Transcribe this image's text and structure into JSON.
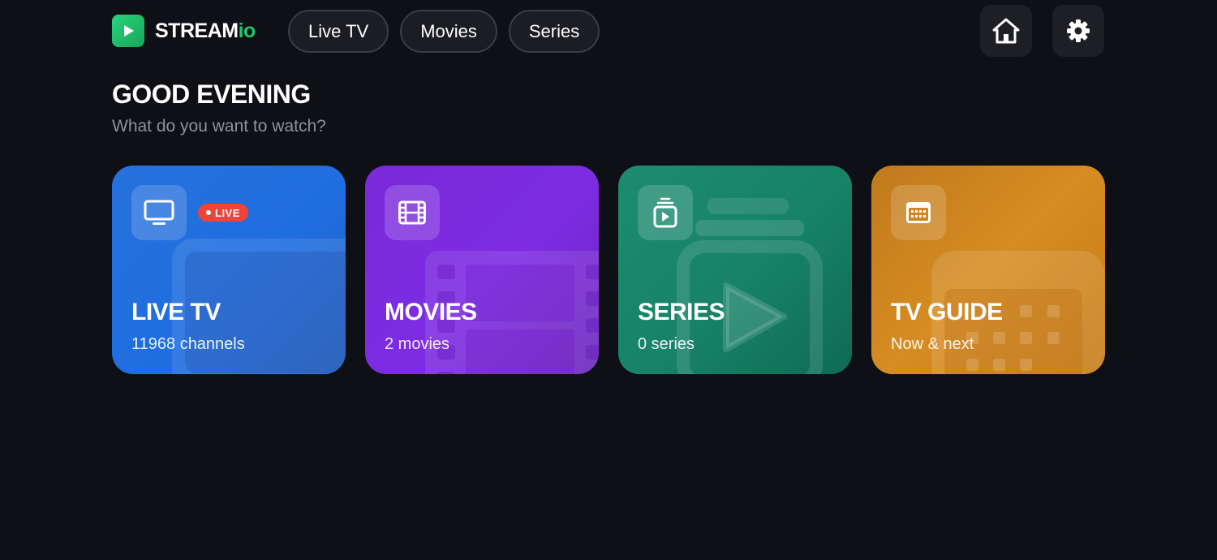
{
  "app": {
    "brand_main": "STREAM",
    "brand_accent": "io",
    "accent_color": "#22c56d",
    "logo_icon": "play-icon"
  },
  "nav": {
    "items": [
      {
        "label": "Live TV"
      },
      {
        "label": "Movies"
      },
      {
        "label": "Series"
      }
    ]
  },
  "toolbar": {
    "home_icon": "home-icon",
    "settings_icon": "gear-icon"
  },
  "greeting": {
    "title": "GOOD EVENING",
    "subtitle": "What do you want to watch?"
  },
  "cards": [
    {
      "title": "LIVE TV",
      "subtitle": "11968 channels",
      "icon": "tv-icon",
      "badge": "LIVE",
      "color": "#1f6ee0"
    },
    {
      "title": "MOVIES",
      "subtitle": "2 movies",
      "icon": "film-icon",
      "color": "#7d2ce3"
    },
    {
      "title": "SERIES",
      "subtitle": "0 series",
      "icon": "series-play-icon",
      "color": "#178266"
    },
    {
      "title": "TV GUIDE",
      "subtitle": "Now & next",
      "icon": "calendar-icon",
      "color": "#d68c22"
    }
  ]
}
